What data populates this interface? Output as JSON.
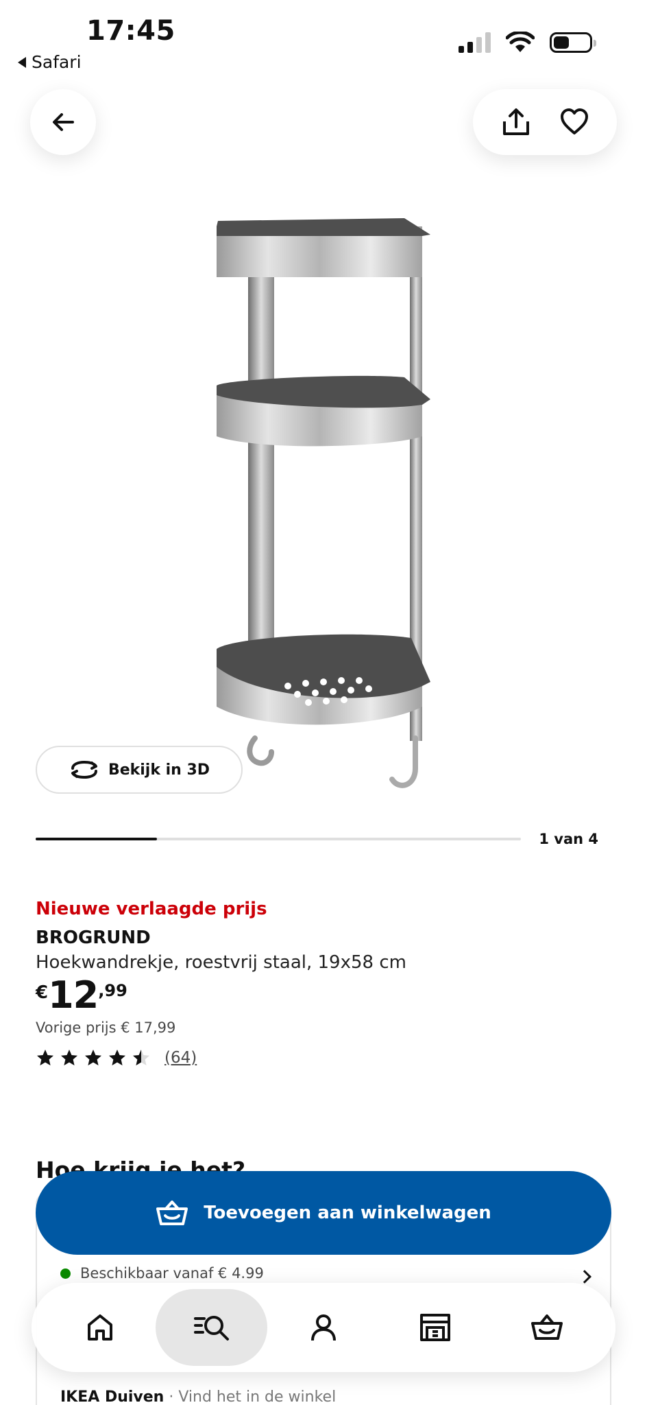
{
  "status_bar": {
    "time": "17:45",
    "back_app": "Safari"
  },
  "top_actions": {
    "back": "arrow-left-icon",
    "share": "share-icon",
    "favorite": "heart-icon"
  },
  "product": {
    "view_3d_label": "Bekijk in 3D",
    "image_index": "1 van 4",
    "gallery_progress": 0.25,
    "promo_label": "Nieuwe verlaagde prijs",
    "name": "BROGRUND",
    "description": "Hoekwandrekje, roestvrij staal, 19x58 cm",
    "price": {
      "currency": "€",
      "integer": "12",
      "decimal": ",99"
    },
    "previous_price": "Vorige prijs € 17,99",
    "rating": {
      "value": 4.5,
      "max": 5,
      "count": "(64)"
    }
  },
  "delivery": {
    "section_title": "Hoe krijg je het?",
    "availability": "Beschikbaar vanaf € 4.99",
    "store": "IKEA Duiven",
    "store_action": "· Vind het in de winkel"
  },
  "cart_button": {
    "label": "Toevoegen aan winkelwagen"
  },
  "bottom_nav": [
    {
      "icon": "home-icon",
      "active": false
    },
    {
      "icon": "search-list-icon",
      "active": true
    },
    {
      "icon": "profile-icon",
      "active": false
    },
    {
      "icon": "store-icon",
      "active": false
    },
    {
      "icon": "cart-icon",
      "active": false
    }
  ],
  "colors": {
    "promo": "#cc0008",
    "primary": "#0058a3",
    "available": "#0a8a00"
  }
}
